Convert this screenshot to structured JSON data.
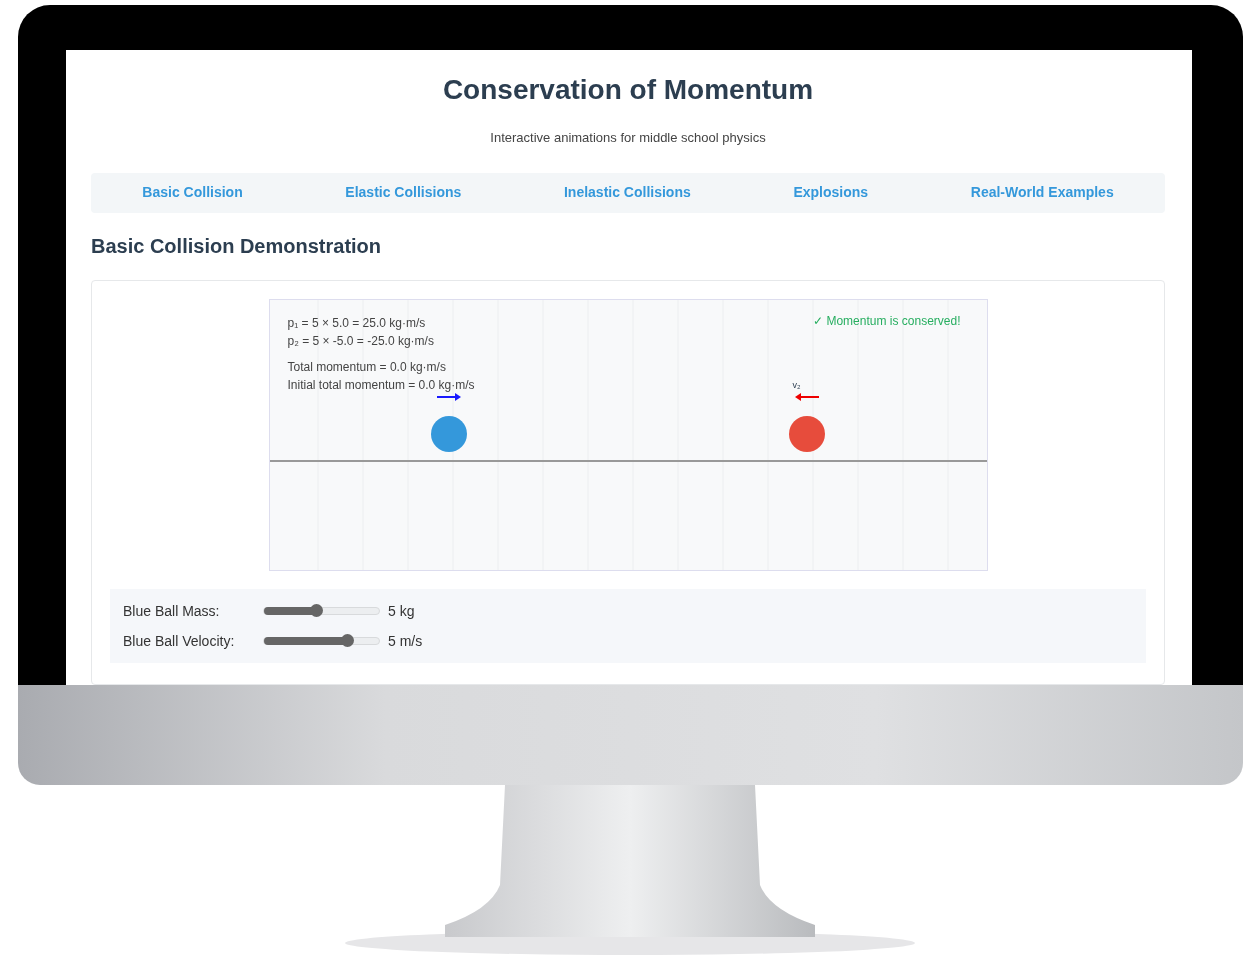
{
  "header": {
    "title": "Conservation of Momentum",
    "subtitle": "Interactive animations for middle school physics"
  },
  "tabs": [
    {
      "label": "Basic Collision",
      "selected": false
    },
    {
      "label": "Elastic Collisions",
      "selected": false
    },
    {
      "label": "Inelastic Collisions",
      "selected": false
    },
    {
      "label": "Explosions",
      "selected": false
    },
    {
      "label": "Real-World Examples",
      "selected": false
    }
  ],
  "section": {
    "heading": "Basic Collision Demonstration"
  },
  "simulation": {
    "equations": [
      "p₁ = 5 × 5.0 = 25.0 kg·m/s",
      "p₂ = 5 × -5.0 = -25.0 kg·m/s"
    ],
    "totals": [
      "Total momentum = 0.0 kg·m/s",
      "Initial total momentum = 0.0 kg·m/s"
    ],
    "status": {
      "text": "✓ Momentum is conserved!",
      "conserved": true
    },
    "balls": [
      {
        "color": "#3498db",
        "moving_right": true
      },
      {
        "color": "#e74c3c",
        "moving_right": false,
        "velocity_label": "v₂"
      }
    ]
  },
  "controls": [
    {
      "label": "Blue Ball Mass:",
      "level": 0.45,
      "reading": "5 kg"
    },
    {
      "label": "Blue Ball Velocity:",
      "level": 0.72,
      "reading": "5 m/s"
    }
  ]
}
